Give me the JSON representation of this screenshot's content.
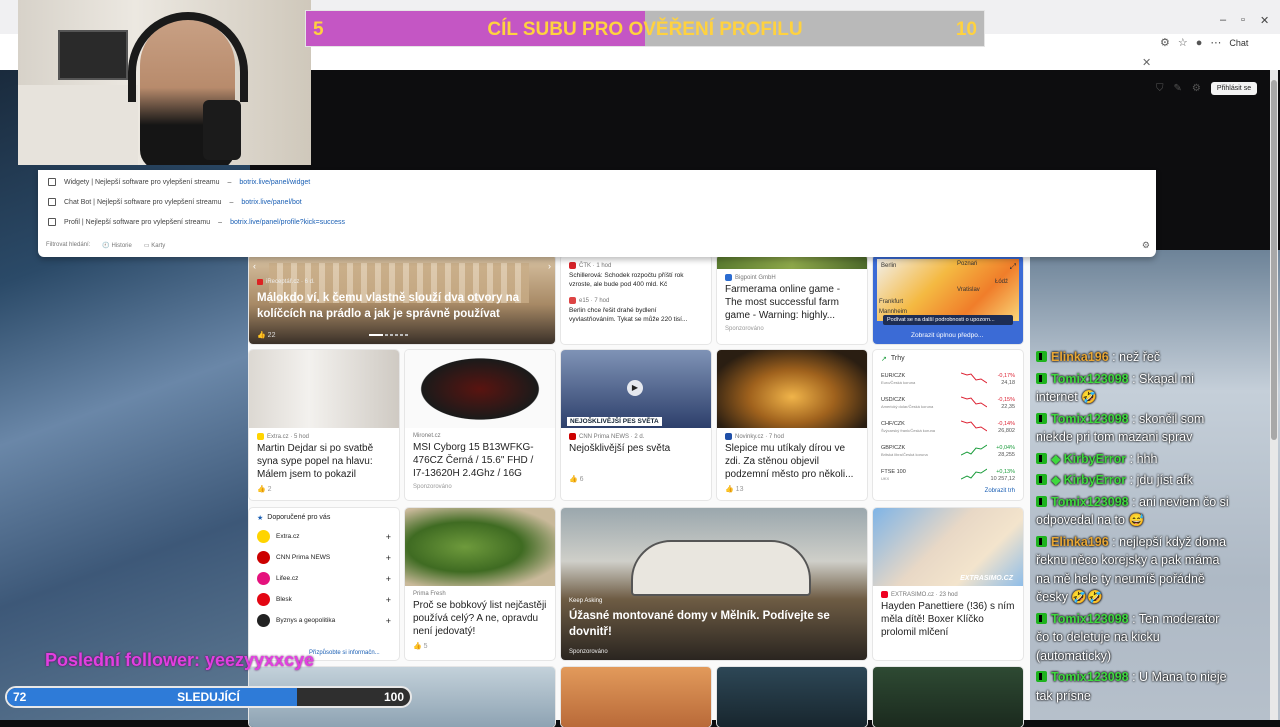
{
  "browser": {
    "chat_label": "Chat",
    "login_label": "Přihlásit se"
  },
  "goal": {
    "current": "5",
    "target": "10",
    "label": "CÍL SUBU PRO OVĚŘENÍ PROFILU",
    "progress": 0.5,
    "fill_color": "#c456c4",
    "text_color": "#ffd23f"
  },
  "omnibox": {
    "rows": [
      {
        "title": "Widgety | Nejlepší software pro vylepšení streamu",
        "sep": "–",
        "url": "botrix.live/panel/widget"
      },
      {
        "title": "Chat Bot | Nejlepší software pro vylepšení streamu",
        "sep": "–",
        "url": "botrix.live/panel/bot"
      },
      {
        "title": "Profil | Nejlepší software pro vylepšení streamu",
        "sep": "–",
        "url": "botrix.live/panel/profile?kick=success"
      }
    ],
    "footer": [
      "Filtrovat hledání:",
      "Historie",
      "Karty"
    ]
  },
  "feed": {
    "hero": {
      "source": "iReceptář.cz · 6 d.",
      "title": "Málokdo ví, k čemu vlastně slouží dva otvory na kolíčcích na prádlo a jak je správně používat",
      "likes": "22"
    },
    "news_a": {
      "source": "ČTK · 1 hod",
      "line1": "Schillerová: Schodek rozpočtu příští rok vzroste, ale bude pod 400 mld. Kč",
      "source2": "e15 · 7 hod",
      "line2": "Berlin chce řešit drahé bydlení vyvlastňováním. Tykat se může 220 tisí..."
    },
    "farm": {
      "source": "Bigpoint GmbH",
      "title": "Farmerama online game - The most successful farm game - Warning: highly...",
      "sponsor": "Sponzorováno"
    },
    "weather": {
      "cities": [
        "Berlin",
        "Poznań",
        "Vratislav",
        "Frankfurt",
        "Mannheim",
        "Łódź"
      ],
      "caption": "Podívat se na další podrobnosti o upozorn...",
      "cta": "Zobrazit úplnou předpo..."
    },
    "row2": [
      {
        "source": "Extra.cz · 5 hod",
        "title": "Martin Dejdar si po svatbě syna sype popel na hlavu: Málem jsem to pokazil",
        "likes": "2"
      },
      {
        "source": "Mironet.cz",
        "title": "MSI Cyborg 15 B13WFKG-476CZ Černá / 15.6\" FHD / I7-13620H 2.4Ghz / 16G",
        "likes": "Sponzorováno"
      },
      {
        "source": "CNN Prima NEWS · 2 d.",
        "title": "Nejošklivější pes světa",
        "likes": "6",
        "overlay": "NEJOŠKLIVĚJŠÍ PES SVĚTA"
      },
      {
        "source": "Novinky.cz · 7 hod",
        "title": "Slepice mu utíkaly dírou ve zdi. Za stěnou objevil podzemní město pro několi...",
        "likes": "13"
      }
    ],
    "markets": {
      "title": "Trhy",
      "rows": [
        {
          "pair": "EUR/CZK",
          "sub": "Euro/Česká koruna",
          "chg": "-0,17%",
          "val": "24,18",
          "up": false
        },
        {
          "pair": "USD/CZK",
          "sub": "Americký dolar/Česká koruna",
          "chg": "-0,15%",
          "val": "22,35",
          "up": false
        },
        {
          "pair": "CHF/CZK",
          "sub": "Švýcarský frank/Česká koruna",
          "chg": "-0,14%",
          "val": "26,802",
          "up": false
        },
        {
          "pair": "GBP/CZK",
          "sub": "Britská libra/Česká koruna",
          "chg": "+0,04%",
          "val": "28,255",
          "up": true
        },
        {
          "pair": "FTSE 100",
          "sub": "UKX",
          "chg": "+0,13%",
          "val": "10 257,12",
          "up": true
        }
      ],
      "more": "Zobrazit trh"
    },
    "recommended": {
      "title": "Doporučené pro vás",
      "items": [
        "Extra.cz",
        "CNN Prima NEWS",
        "Lifee.cz",
        "Blesk",
        "Byznys a geopolitika"
      ],
      "more": "Přizpůsobte si informačn..."
    },
    "bay": {
      "source": "Prima Fresh",
      "title": "Proč se bobkový list nejčastěji používá celý? A ne, opravdu není jedovatý!",
      "likes": "5"
    },
    "homes": {
      "label": "Keep Asking",
      "title": "Úžasné montované domy v Mělník. Podívejte se dovnitř!",
      "sponsor": "Sponzorováno"
    },
    "hayden": {
      "source": "EXTRASIMO.cz · 23 hod",
      "title": "Hayden Panettiere (!36) s ním měla dítě! Boxer Klíčko prolomil mlčení",
      "watermark": "EXTRASIMO.CZ"
    }
  },
  "chat": [
    {
      "user": "Elinka196",
      "color": "#e8a736",
      "text": "už to dává smysl",
      "extra_badge": false
    },
    {
      "user": "Elinka196",
      "color": "#e8a736",
      "text": ": než řeč",
      "extra_badge": false
    },
    {
      "user": "Tomix123098",
      "color": "#3fd93f",
      "text": ": Skapal mi internet 🤣",
      "extra_badge": false
    },
    {
      "user": "Tomix123098",
      "color": "#3fd93f",
      "text": ": skončil som niekde pri tom mazani sprav",
      "extra_badge": false
    },
    {
      "user": "KirbyError",
      "color": "#3fd93f",
      "text": ": hhh",
      "extra_badge": true
    },
    {
      "user": "KirbyError",
      "color": "#3fd93f",
      "text": ": jdu jíst afk",
      "extra_badge": true
    },
    {
      "user": "Tomix123098",
      "color": "#3fd93f",
      "text": ": ani neviem čo si odpovedal na to 😅",
      "extra_badge": false
    },
    {
      "user": "Elinka196",
      "color": "#e8a736",
      "text": ": nejlepší když doma řeknu něco korejsky a pak máma na mě hele ty neumíš pořádně česky 🤣🤣",
      "extra_badge": false
    },
    {
      "user": "Tomix123098",
      "color": "#3fd93f",
      "text": ": Ten moderator čo to deletuje na kicku (automaticky)",
      "extra_badge": false
    },
    {
      "user": "Tomix123098",
      "color": "#3fd93f",
      "text": ": U Mana to nieje tak prísne",
      "extra_badge": false
    }
  ],
  "follower": {
    "label": "Poslední follower: yeezyyxxcye"
  },
  "follow_goal": {
    "current": "72",
    "label": "SLEDUJÍCÍ",
    "target": "100",
    "progress": 0.72
  }
}
